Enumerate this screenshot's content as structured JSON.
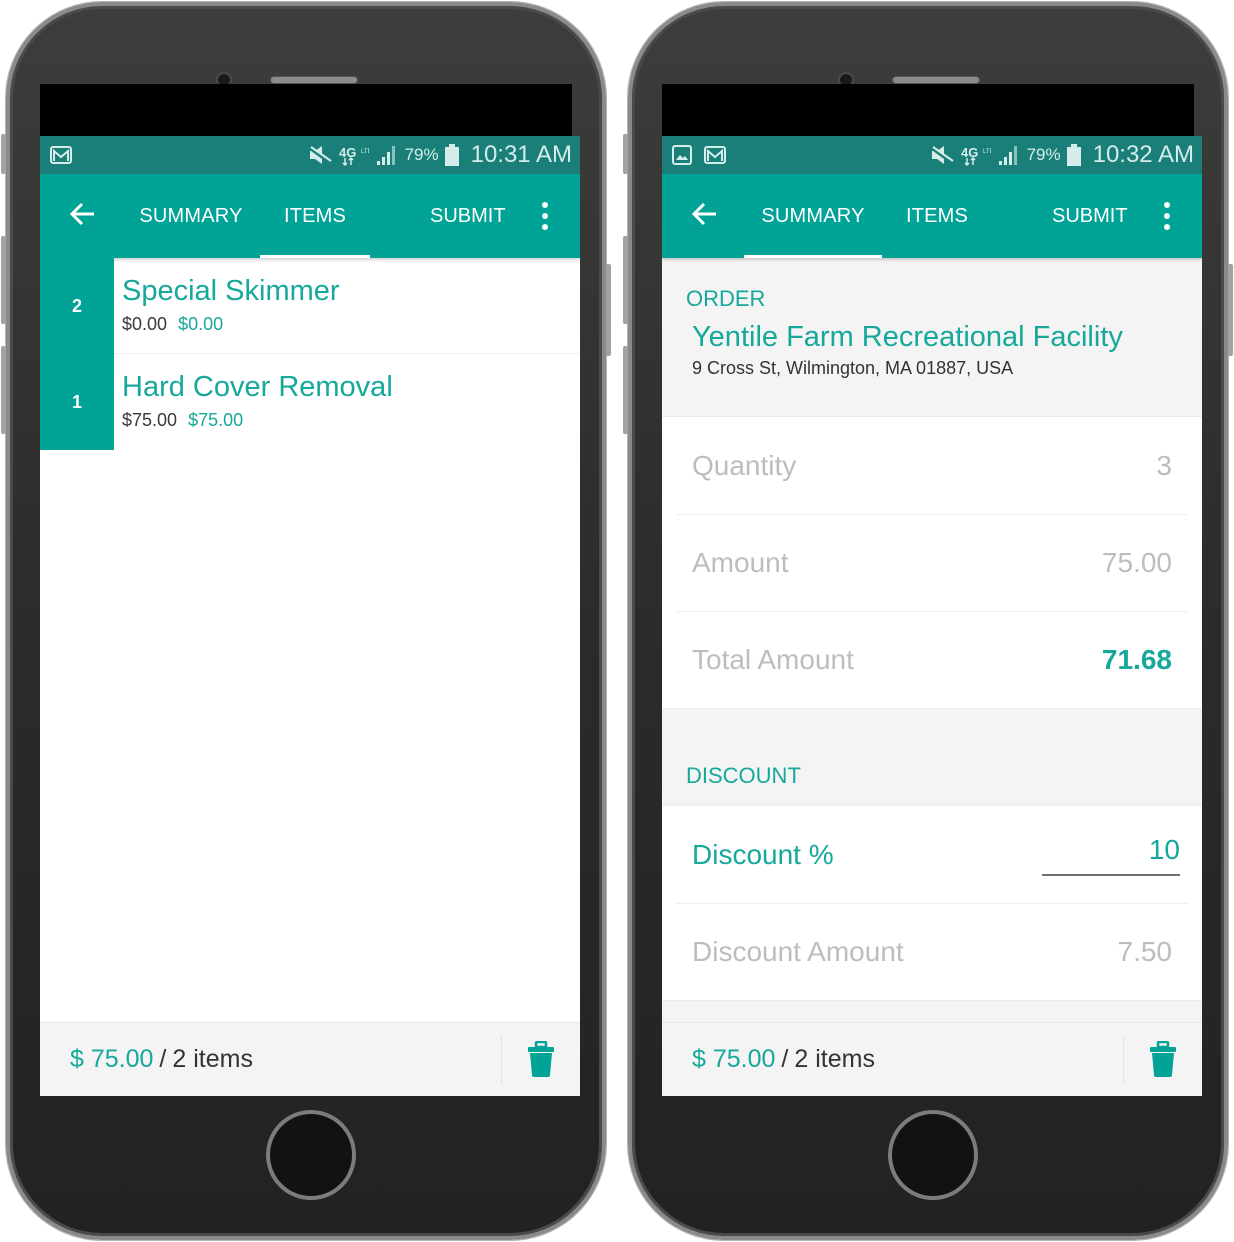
{
  "colors": {
    "primary": "#00a396",
    "status_bar": "#1a7f78",
    "accent_text": "#16a89b",
    "muted_text": "#bdbdbd"
  },
  "left_phone": {
    "status_bar": {
      "left_icons": [
        "gmail-icon"
      ],
      "right_icons": [
        "mute-icon",
        "4g-lte-icon",
        "signal-icon"
      ],
      "battery_pct": "79%",
      "time": "10:31 AM"
    },
    "toolbar": {
      "back_icon": "arrow-left-icon",
      "tabs": [
        {
          "label": "SUMMARY",
          "active": false
        },
        {
          "label": "ITEMS",
          "active": true
        }
      ],
      "submit_label": "SUBMIT",
      "menu_icon": "more-vert-icon"
    },
    "items": [
      {
        "qty": "2",
        "name": "Special Skimmer",
        "price": "$0.00",
        "total": "$0.00"
      },
      {
        "qty": "1",
        "name": "Hard Cover Removal",
        "price": "$75.00",
        "total": "$75.00"
      }
    ],
    "footer": {
      "total": "$ 75.00",
      "separator": "/",
      "count": "2 items",
      "delete_icon": "trash-icon"
    }
  },
  "right_phone": {
    "status_bar": {
      "left_icons": [
        "image-icon",
        "gmail-icon"
      ],
      "right_icons": [
        "mute-icon",
        "4g-lte-icon",
        "signal-icon"
      ],
      "battery_pct": "79%",
      "time": "10:32 AM"
    },
    "toolbar": {
      "back_icon": "arrow-left-icon",
      "tabs": [
        {
          "label": "SUMMARY",
          "active": true
        },
        {
          "label": "ITEMS",
          "active": false
        }
      ],
      "submit_label": "SUBMIT",
      "menu_icon": "more-vert-icon"
    },
    "order": {
      "section_label": "ORDER",
      "customer_name": "Yentile Farm Recreational Facility",
      "customer_address": "9 Cross St, Wilmington, MA 01887, USA",
      "fields": [
        {
          "label": "Quantity",
          "value": "3"
        },
        {
          "label": "Amount",
          "value": "75.00"
        },
        {
          "label": "Total Amount",
          "value": "71.68"
        }
      ]
    },
    "discount": {
      "section_label": "DISCOUNT",
      "percent_label": "Discount %",
      "percent_value": "10",
      "amount_label": "Discount Amount",
      "amount_value": "7.50"
    },
    "footer": {
      "total": "$ 75.00",
      "separator": "/",
      "count": "2 items",
      "delete_icon": "trash-icon"
    }
  }
}
